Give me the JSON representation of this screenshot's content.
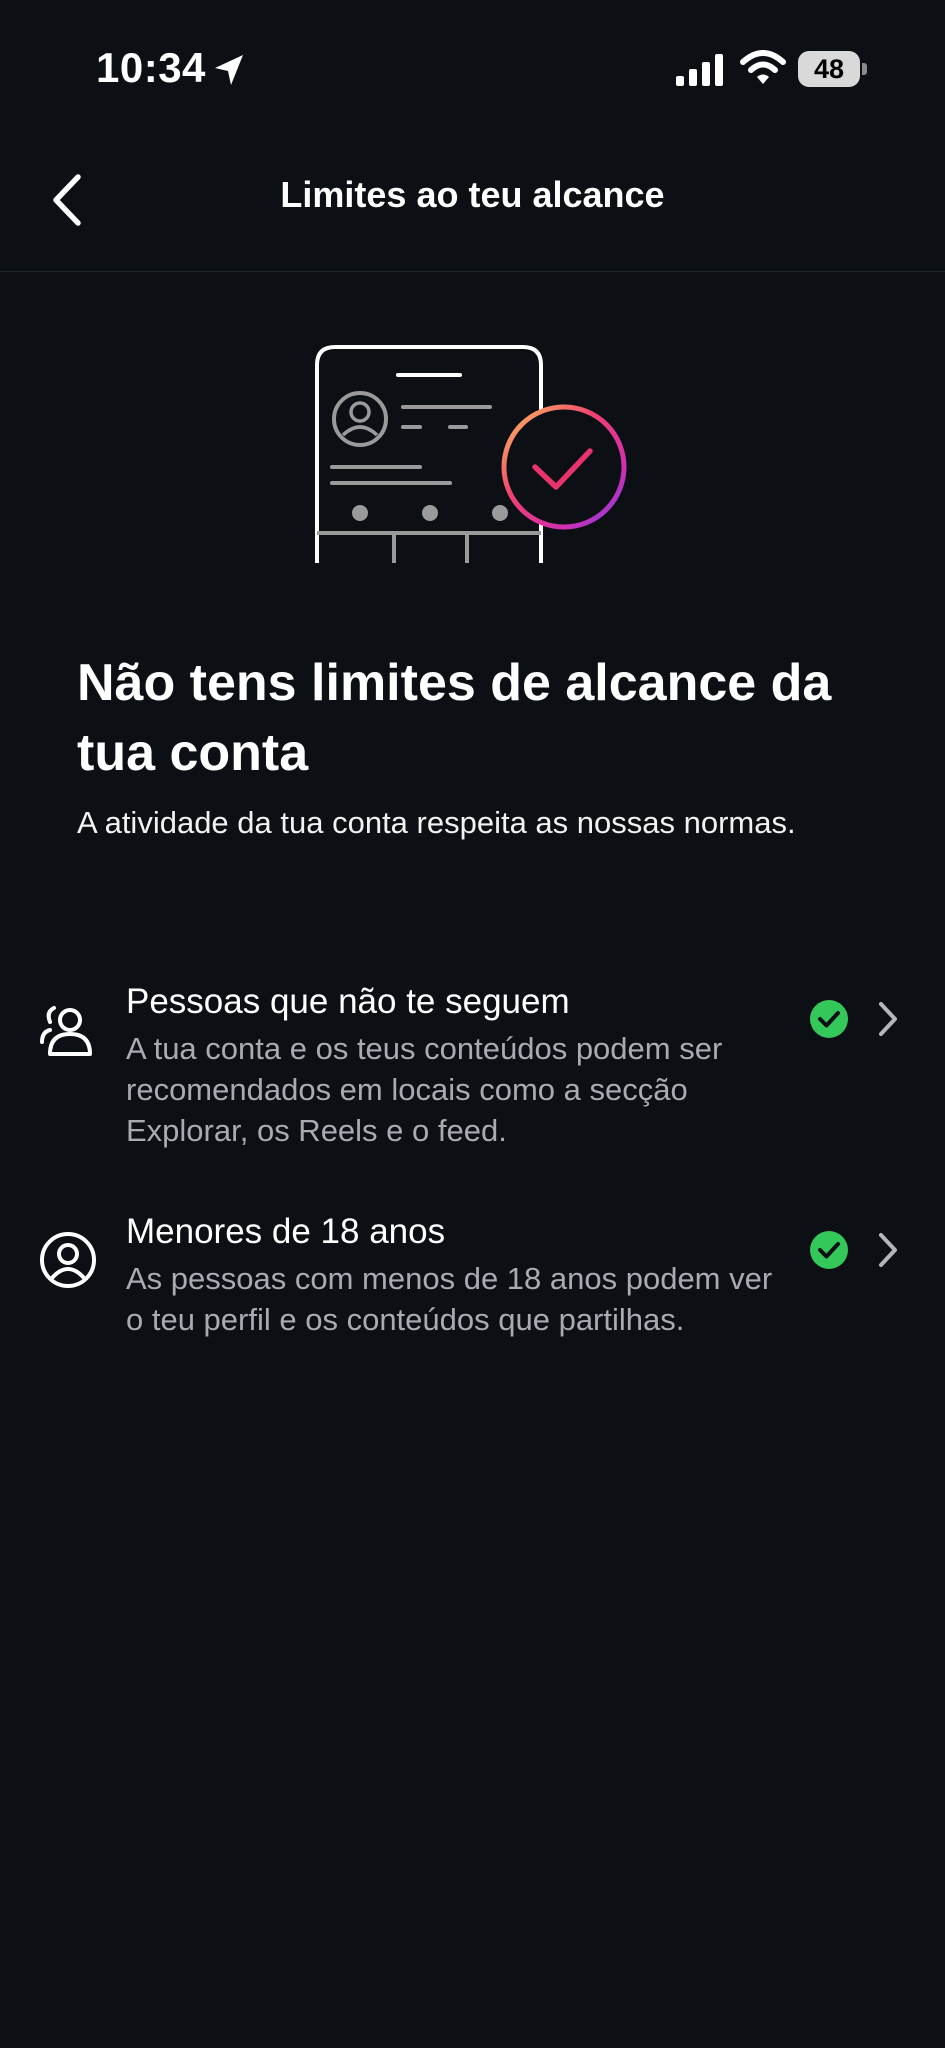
{
  "status_bar": {
    "time": "10:34",
    "battery": "48"
  },
  "header": {
    "title": "Limites ao teu alcance"
  },
  "main": {
    "headline": "Não tens limites de alcance da tua conta",
    "subtitle": "A atividade da tua conta respeita as nossas normas."
  },
  "items": [
    {
      "title": "Pessoas que não te seguem",
      "description": "A tua conta e os teus conteúdos podem ser recomendados em locais como a secção Explorar, os Reels e o feed.",
      "icon": "people-icon",
      "status": "check"
    },
    {
      "title": "Menores de 18 anos",
      "description": "As pessoas com menos de 18 anos podem ver o teu perfil e os conteúdos que partilhas.",
      "icon": "profile-icon",
      "status": "check"
    }
  ],
  "colors": {
    "background": "#0c0f14",
    "check_green": "#34c759",
    "secondary_text": "#a8abb2"
  }
}
